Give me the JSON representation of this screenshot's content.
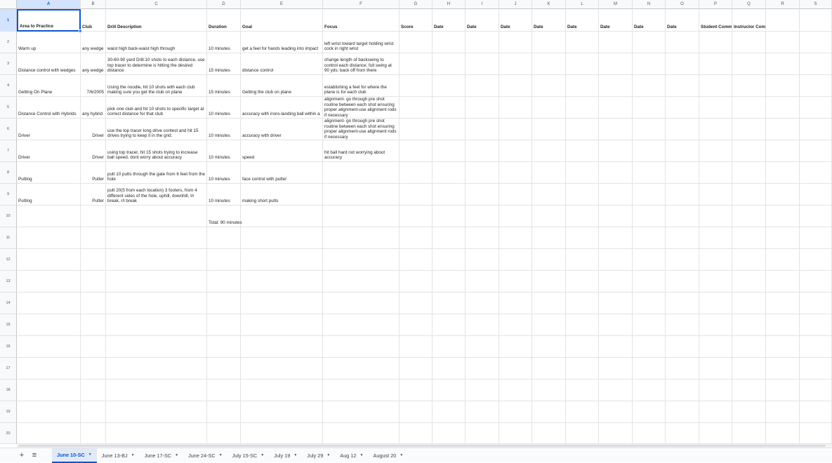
{
  "columns": [
    "A",
    "B",
    "C",
    "D",
    "E",
    "F",
    "G",
    "H",
    "I",
    "J",
    "K",
    "L",
    "M",
    "N",
    "O",
    "P",
    "Q",
    "R",
    "S"
  ],
  "rows": [
    "1",
    "2",
    "3",
    "4",
    "5",
    "6",
    "7",
    "8",
    "9",
    "10",
    "11",
    "12",
    "13",
    "14",
    "15",
    "16",
    "17",
    "18",
    "19",
    "20"
  ],
  "headers": {
    "area": "Area to Practice",
    "club": "Club",
    "drill": "Drill Description",
    "duration": "Duration",
    "goal": "Goal",
    "focus": "Focus",
    "score": "Score",
    "date1": "Date",
    "date2": "Date",
    "date3": "Date",
    "date4": "Date",
    "date5": "Date",
    "date6": "Date",
    "date7": "Date",
    "date8": "Date",
    "student": "Student Comm",
    "instructor": "Instructor Comments"
  },
  "data_rows": [
    {
      "area": "Warm up",
      "club": "any wedge",
      "drill": "waist high back-waist high through",
      "duration": "10 minutes",
      "goal": "get a feel for hands leading into impact",
      "focus": "left wrist toward target holding wrist cock in right wrist"
    },
    {
      "area": "Distance control with wedges",
      "club": "any wedge",
      "drill": "30-60-90 yard Drill:10 shots to each distance, use top tracer to determine is hitting the desired distance",
      "duration": "15 minutes",
      "goal": "distance control",
      "focus": "change length of backswing to control each distance; full swing at 90 yds; back off from there"
    },
    {
      "area": "Getting On Plane",
      "club": "7/6/2005",
      "drill": "Using the noodle, hit 10 shots with each club making sure you get the club on plane",
      "duration": "15 minutes",
      "goal": "Getting the club on plane",
      "focus": "establishing a feel for where the plane is for each club"
    },
    {
      "area": "Distance Control with Hybrids",
      "club": "any hybrid",
      "drill": "pick one club and hit 10 shots to specific target at correct distance for that club",
      "duration": "10 minutes",
      "goal": "accuracy with irons-landing ball within a",
      "focus": "alignment- go through pre shot routine between each shot ensuring proper alignment-use alignment rods if necessary"
    },
    {
      "area": "Driver",
      "club": "Driver",
      "drill": "use the top tracer long drive contest and hit 15 drives trying to keep it in the grid.",
      "duration": "10 minutes",
      "goal": "accuracy with driver",
      "focus": "alignment- go through pre shot routine between each shot ensuring proper alignment-use alignment rods if necessary"
    },
    {
      "area": "Driver",
      "club": "Driver",
      "drill": "using top tracer, hit 15 shots trying to increase ball speed, dont worry about accuracy",
      "duration": "10 minutes",
      "goal": "speed",
      "focus": "hit ball hard not worrying about accuracy"
    },
    {
      "area": "Putting",
      "club": "Putter",
      "drill": "putt 10 putts through the gate from 6 feet from the hole",
      "duration": "10 minutes",
      "goal": "face control with putter",
      "focus": ""
    },
    {
      "area": "Putting",
      "club": "Putter",
      "drill": "putt 20(5 from each location) 3 footers, from 4 different sides of the hole, uphill, downhill, l/r break, r/l break",
      "duration": "10 minutes",
      "goal": "making short putts",
      "focus": ""
    }
  ],
  "total": "Total: 90 minutes",
  "sheet_tabs": [
    "June 10-SC",
    "June 13-BJ",
    "June 17-SC",
    "June 24-SC",
    "July 15-SC",
    "July 19",
    "July 29",
    "Aug 12",
    "August 20"
  ],
  "active_tab": "June 10-SC",
  "icons": {
    "add_sheet": "plus-icon",
    "all_sheets": "menu-icon",
    "tab_menu": "caret-down-icon"
  },
  "colors": {
    "selection": "#0b57d0",
    "header_selected_bg": "#d3e3fd",
    "active_tab_bg": "#e1e9f7"
  }
}
